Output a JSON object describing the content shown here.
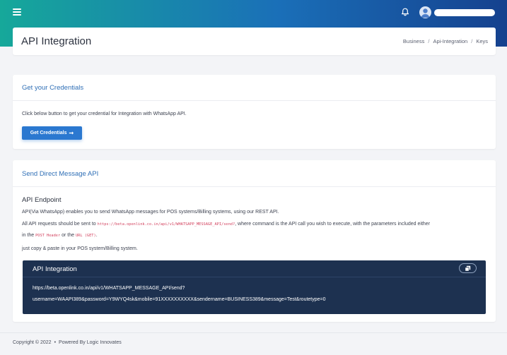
{
  "topbar": {
    "menu_icon": "hamburger-menu-icon",
    "notification_icon": "bell-icon",
    "avatar_icon": "user-avatar-icon"
  },
  "header": {
    "title": "API Integration",
    "breadcrumb": [
      "Business",
      "Api-Integration",
      "Keys"
    ]
  },
  "credentials": {
    "title": "Get your Credentials",
    "text": "Click below button to get your credential for Integration with WhatsApp API.",
    "button_label": "Get Credentials",
    "button_icon": "arrow-right-icon"
  },
  "direct_message": {
    "title": "Send Direct Message API",
    "endpoint_heading": "API Endpoint",
    "description": "API(Via WhatsApp) enables you to send WhatsApp messages for POS systems/Billing systems, using our REST API.",
    "requests_prefix": "All API requests should be sent to",
    "requests_url": "https://beta.openlink.co.in/api/v1/WHATSAPP_MESSAGE_API/send?",
    "requests_suffix": ", where command is the API call you wish to execute, with the parameters included either",
    "params_prefix": "in the",
    "params_post": "POST Header",
    "params_or": "or the",
    "params_get": "URL (GET)",
    "params_end": ".",
    "copy_paste_text": "just copy & paste in your POS system/Billing system."
  },
  "code_panel": {
    "title": "API Integration",
    "copy_icon": "copy-icon",
    "line_1": "https://beta.openlink.co.in/api/v1/WHATSAPP_MESSAGE_API/send?",
    "line_2": "username=WAAPI389&password=Y9WYQ4sk&mobile=91XXXXXXXXXX&sendername=BUSINESS389&message=Test&routetype=0"
  },
  "footer": {
    "copyright": "Copyright © 2022",
    "powered": "Powered By Logic Innovates"
  },
  "colors": {
    "topbar_gradient": [
      "#16a89a",
      "#1a6fb8",
      "#15418e"
    ],
    "accent": "#2b78d0",
    "card_title": "#2f6fb6",
    "code_panel_bg": "#1d3150",
    "inline_code": "#d23f5c"
  }
}
